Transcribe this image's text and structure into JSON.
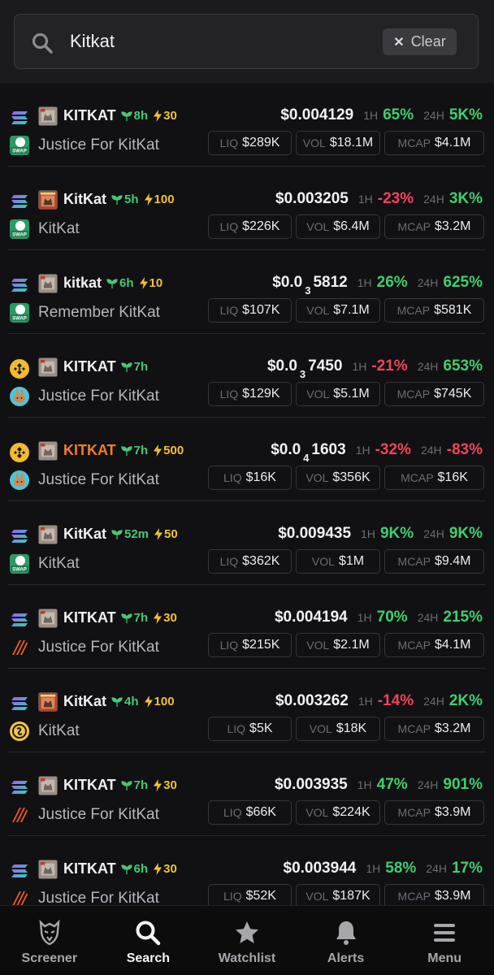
{
  "search": {
    "value": "Kitkat",
    "clear_label": "Clear"
  },
  "labels": {
    "h1": "1H",
    "h24": "24H",
    "liq": "LIQ",
    "vol": "VOL",
    "mcap": "MCAP"
  },
  "rows": [
    {
      "chain_icon": "solana-icon",
      "dex_icon": "swap-icon",
      "token_img": "cat-image",
      "symbol": "KITKAT",
      "symbol_warn": false,
      "age": "8h",
      "boost": "30",
      "name": "Justice For KitKat",
      "price_main": "$0.004129",
      "price_sub": "",
      "price_tail": "",
      "h1": "65%",
      "h1_dir": "pos",
      "h24": "5K%",
      "h24_dir": "pos",
      "liq": "$289K",
      "vol": "$18.1M",
      "mcap": "$4.1M"
    },
    {
      "chain_icon": "solana-icon",
      "dex_icon": "swap-icon",
      "token_img": "cat-image-red",
      "symbol": "KitKat",
      "symbol_warn": false,
      "age": "5h",
      "boost": "100",
      "name": "KitKat",
      "price_main": "$0.003205",
      "price_sub": "",
      "price_tail": "",
      "h1": "-23%",
      "h1_dir": "neg",
      "h24": "3K%",
      "h24_dir": "pos",
      "liq": "$226K",
      "vol": "$6.4M",
      "mcap": "$3.2M"
    },
    {
      "chain_icon": "solana-icon",
      "dex_icon": "swap-icon",
      "token_img": "cat-image",
      "symbol": "kitkat",
      "symbol_warn": false,
      "age": "6h",
      "boost": "10",
      "name": "Remember KitKat",
      "price_main": "$0.0",
      "price_sub": "3",
      "price_tail": "5812",
      "h1": "26%",
      "h1_dir": "pos",
      "h24": "625%",
      "h24_dir": "pos",
      "liq": "$107K",
      "vol": "$7.1M",
      "mcap": "$581K"
    },
    {
      "chain_icon": "bnb-icon",
      "dex_icon": "pancakeswap-icon",
      "token_img": "cat-image",
      "symbol": "KITKAT",
      "symbol_warn": false,
      "age": "7h",
      "boost": "",
      "name": "Justice For KitKat",
      "price_main": "$0.0",
      "price_sub": "3",
      "price_tail": "7450",
      "h1": "-21%",
      "h1_dir": "neg",
      "h24": "653%",
      "h24_dir": "pos",
      "liq": "$129K",
      "vol": "$5.1M",
      "mcap": "$745K"
    },
    {
      "chain_icon": "bnb-icon",
      "dex_icon": "pancakeswap-icon",
      "token_img": "cat-image",
      "symbol": "KITKAT",
      "symbol_warn": true,
      "age": "7h",
      "boost": "500",
      "name": "Justice For KitKat",
      "price_main": "$0.0",
      "price_sub": "4",
      "price_tail": "1603",
      "h1": "-32%",
      "h1_dir": "neg",
      "h24": "-83%",
      "h24_dir": "neg",
      "liq": "$16K",
      "vol": "$356K",
      "mcap": "$16K"
    },
    {
      "chain_icon": "solana-icon",
      "dex_icon": "swap-icon",
      "token_img": "cat-image",
      "symbol": "KitKat",
      "symbol_warn": false,
      "age": "52m",
      "boost": "50",
      "name": "KitKat",
      "price_main": "$0.009435",
      "price_sub": "",
      "price_tail": "",
      "h1": "9K%",
      "h1_dir": "pos",
      "h24": "9K%",
      "h24_dir": "pos",
      "liq": "$362K",
      "vol": "$1M",
      "mcap": "$9.4M"
    },
    {
      "chain_icon": "solana-icon",
      "dex_icon": "stripes-dex-icon",
      "token_img": "cat-image",
      "symbol": "KITKAT",
      "symbol_warn": false,
      "age": "7h",
      "boost": "30",
      "name": "Justice For KitKat",
      "price_main": "$0.004194",
      "price_sub": "",
      "price_tail": "",
      "h1": "70%",
      "h1_dir": "pos",
      "h24": "215%",
      "h24_dir": "pos",
      "liq": "$215K",
      "vol": "$2.1M",
      "mcap": "$4.1M"
    },
    {
      "chain_icon": "solana-icon",
      "dex_icon": "coin-dex-icon",
      "token_img": "cat-image-red",
      "symbol": "KitKat",
      "symbol_warn": false,
      "age": "4h",
      "boost": "100",
      "name": "KitKat",
      "price_main": "$0.003262",
      "price_sub": "",
      "price_tail": "",
      "h1": "-14%",
      "h1_dir": "neg",
      "h24": "2K%",
      "h24_dir": "pos",
      "liq": "$5K",
      "vol": "$18K",
      "mcap": "$3.2M"
    },
    {
      "chain_icon": "solana-icon",
      "dex_icon": "stripes-dex-icon",
      "token_img": "cat-image",
      "symbol": "KITKAT",
      "symbol_warn": false,
      "age": "7h",
      "boost": "30",
      "name": "Justice For KitKat",
      "price_main": "$0.003935",
      "price_sub": "",
      "price_tail": "",
      "h1": "47%",
      "h1_dir": "pos",
      "h24": "901%",
      "h24_dir": "pos",
      "liq": "$66K",
      "vol": "$224K",
      "mcap": "$3.9M"
    },
    {
      "chain_icon": "solana-icon",
      "dex_icon": "stripes-dex-icon",
      "token_img": "cat-image",
      "symbol": "KITKAT",
      "symbol_warn": false,
      "age": "6h",
      "boost": "30",
      "name": "Justice For KitKat",
      "price_main": "$0.003944",
      "price_sub": "",
      "price_tail": "",
      "h1": "58%",
      "h1_dir": "pos",
      "h24": "17%",
      "h24_dir": "pos",
      "liq": "$52K",
      "vol": "$187K",
      "mcap": "$3.9M"
    }
  ],
  "nav": [
    {
      "label": "Screener",
      "icon": "eagle-icon",
      "active": false
    },
    {
      "label": "Search",
      "icon": "search-icon",
      "active": true
    },
    {
      "label": "Watchlist",
      "icon": "star-icon",
      "active": false
    },
    {
      "label": "Alerts",
      "icon": "bell-icon",
      "active": false
    },
    {
      "label": "Menu",
      "icon": "menu-icon",
      "active": false
    }
  ]
}
